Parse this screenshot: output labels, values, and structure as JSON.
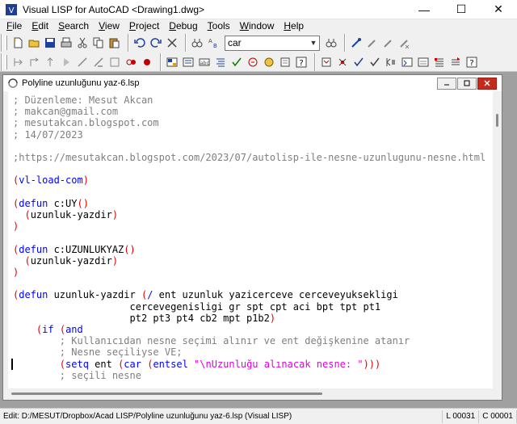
{
  "window": {
    "title": "Visual LISP for AutoCAD <Drawing1.dwg>",
    "minimize_glyph": "—",
    "maximize_glyph": "☐",
    "close_glyph": "✕"
  },
  "menu": [
    {
      "label": "File",
      "underline": "F",
      "rest": "ile"
    },
    {
      "label": "Edit",
      "underline": "E",
      "rest": "dit"
    },
    {
      "label": "Search",
      "underline": "S",
      "rest": "earch"
    },
    {
      "label": "View",
      "underline": "V",
      "rest": "iew"
    },
    {
      "label": "Project",
      "underline": "P",
      "rest": "roject"
    },
    {
      "label": "Debug",
      "underline": "D",
      "rest": "ebug"
    },
    {
      "label": "Tools",
      "underline": "T",
      "rest": "ools"
    },
    {
      "label": "Window",
      "underline": "W",
      "rest": "indow"
    },
    {
      "label": "Help",
      "underline": "H",
      "rest": "elp"
    }
  ],
  "toolbar": {
    "search_combo_value": "car"
  },
  "document": {
    "title": "Polyline uzunluğunu yaz-6.lsp"
  },
  "code_lines": [
    [
      {
        "t": "; Düzenleme: Mesut Akcan",
        "c": "comment"
      }
    ],
    [
      {
        "t": "; makcan@gmail.com",
        "c": "comment"
      }
    ],
    [
      {
        "t": "; mesutakcan.blogspot.com",
        "c": "comment"
      }
    ],
    [
      {
        "t": "; 14/07/2023",
        "c": "comment"
      }
    ],
    [],
    [
      {
        "t": ";https://mesutakcan.blogspot.com/2023/07/autolisp-ile-nesne-uzunlugunu-nesne.html",
        "c": "comment"
      }
    ],
    [],
    [
      {
        "t": "(",
        "c": "paren"
      },
      {
        "t": "vl-load-com",
        "c": "kw"
      },
      {
        "t": ")",
        "c": "paren"
      }
    ],
    [],
    [
      {
        "t": "(",
        "c": "paren"
      },
      {
        "t": "defun",
        "c": "kw"
      },
      {
        "t": " c:UY",
        "c": "sym"
      },
      {
        "t": "()",
        "c": "paren"
      }
    ],
    [
      {
        "t": "  ",
        "c": "sym"
      },
      {
        "t": "(",
        "c": "paren"
      },
      {
        "t": "uzunluk-yazdir",
        "c": "sym"
      },
      {
        "t": ")",
        "c": "paren"
      }
    ],
    [
      {
        "t": ")",
        "c": "paren"
      }
    ],
    [],
    [
      {
        "t": "(",
        "c": "paren"
      },
      {
        "t": "defun",
        "c": "kw"
      },
      {
        "t": " c:UZUNLUKYAZ",
        "c": "sym"
      },
      {
        "t": "()",
        "c": "paren"
      }
    ],
    [
      {
        "t": "  ",
        "c": "sym"
      },
      {
        "t": "(",
        "c": "paren"
      },
      {
        "t": "uzunluk-yazdir",
        "c": "sym"
      },
      {
        "t": ")",
        "c": "paren"
      }
    ],
    [
      {
        "t": ")",
        "c": "paren"
      }
    ],
    [],
    [
      {
        "t": "(",
        "c": "paren"
      },
      {
        "t": "defun",
        "c": "kw"
      },
      {
        "t": " uzunluk-yazdir ",
        "c": "sym"
      },
      {
        "t": "(",
        "c": "paren"
      },
      {
        "t": "/",
        "c": "kw"
      },
      {
        "t": " ent uzunluk yazicerceve cerceveyuksekligi",
        "c": "sym"
      }
    ],
    [
      {
        "t": "                    cercevegenisligi gr spt cpt aci bpt tpt pt1",
        "c": "sym"
      }
    ],
    [
      {
        "t": "                    pt2 pt3 pt4 cb2 mpt p1b2",
        "c": "sym"
      },
      {
        "t": ")",
        "c": "paren"
      }
    ],
    [
      {
        "t": "    ",
        "c": "sym"
      },
      {
        "t": "(",
        "c": "paren"
      },
      {
        "t": "if",
        "c": "kw"
      },
      {
        "t": " ",
        "c": "sym"
      },
      {
        "t": "(",
        "c": "paren"
      },
      {
        "t": "and",
        "c": "kw"
      }
    ],
    [
      {
        "t": "        ; Kullanıcıdan nesne seçimi alınır ve ent değişkenine atanır",
        "c": "comment"
      }
    ],
    [
      {
        "t": "        ; Nesne seçiliyse VE;",
        "c": "comment"
      }
    ],
    [
      {
        "t": "        ",
        "c": "sym"
      },
      {
        "t": "(",
        "c": "paren"
      },
      {
        "t": "setq",
        "c": "kw"
      },
      {
        "t": " ent ",
        "c": "sym"
      },
      {
        "t": "(",
        "c": "paren"
      },
      {
        "t": "car",
        "c": "kw"
      },
      {
        "t": " ",
        "c": "sym"
      },
      {
        "t": "(",
        "c": "paren"
      },
      {
        "t": "entsel",
        "c": "kw"
      },
      {
        "t": " ",
        "c": "sym"
      },
      {
        "t": "\"\\nUzunluğu alınacak nesne: \"",
        "c": "str"
      },
      {
        "t": ")))",
        "c": "paren"
      }
    ],
    [
      {
        "t": "        ; seçili nesne",
        "c": "comment"
      }
    ]
  ],
  "status": {
    "edit_path": "Edit:  D:/MESUT/Dropbox/Acad LISP/Polyline uzunluğunu yaz-6.lsp   (Visual LISP)",
    "line": "L 00031",
    "col": "C 00001"
  },
  "colors": {
    "comment": "#7f7f7f",
    "paren": "#e00000",
    "keyword": "#0000ff",
    "string": "#e000e0",
    "chrome": "#f0f0f0",
    "mdi_background": "#a0a0a0"
  }
}
